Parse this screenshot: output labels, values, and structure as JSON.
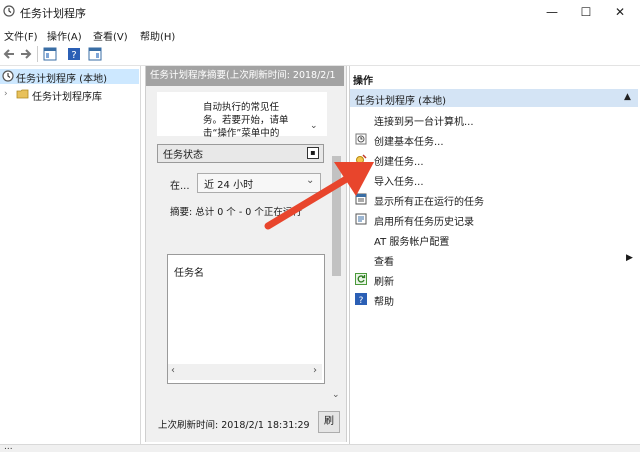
{
  "window": {
    "title": "任务计划程序",
    "minimize": "—",
    "maximize": "☐",
    "close": "✕"
  },
  "menu": [
    "文件(F)",
    "操作(A)",
    "查看(V)",
    "帮助(H)"
  ],
  "tree": {
    "root": "任务计划程序 (本地)",
    "library": "任务计划程序库"
  },
  "center": {
    "header": "任务计划程序摘要(上次刷新时间: 2018/2/1",
    "description": [
      "自动执行的常见任",
      "务。若要开始，请单",
      "击“操作”菜单中的"
    ],
    "status_section": "任务状态",
    "collapse_glyph": "▪",
    "period_label": "在...",
    "period_value": "近 24 小时",
    "summary": "摘要: 总计 0 个 - 0 个正在运行",
    "task_column": "任务名",
    "last_refresh": "上次刷新时间: 2018/2/1 18:31:29",
    "refresh_button": "刷"
  },
  "actions": {
    "title": "操作",
    "group": "任务计划程序 (本地)",
    "items": [
      {
        "label": "连接到另一台计算机...",
        "icon": "none"
      },
      {
        "label": "创建基本任务...",
        "icon": "basic-task-icon"
      },
      {
        "label": "创建任务...",
        "icon": "create-task-icon"
      },
      {
        "label": "导入任务...",
        "icon": "none"
      },
      {
        "label": "显示所有正在运行的任务",
        "icon": "running-tasks-icon"
      },
      {
        "label": "启用所有任务历史记录",
        "icon": "history-icon"
      },
      {
        "label": "AT 服务帐户配置",
        "icon": "none"
      },
      {
        "label": "查看",
        "icon": "none",
        "submenu": true
      },
      {
        "label": "刷新",
        "icon": "refresh-icon"
      },
      {
        "label": "帮助",
        "icon": "help-icon"
      }
    ]
  },
  "statusbar": "...",
  "colors": {
    "selection": "#cde8ff",
    "group_header": "#d4e4f5",
    "center_header": "#a3a3a3",
    "arrow": "#e8452c"
  }
}
